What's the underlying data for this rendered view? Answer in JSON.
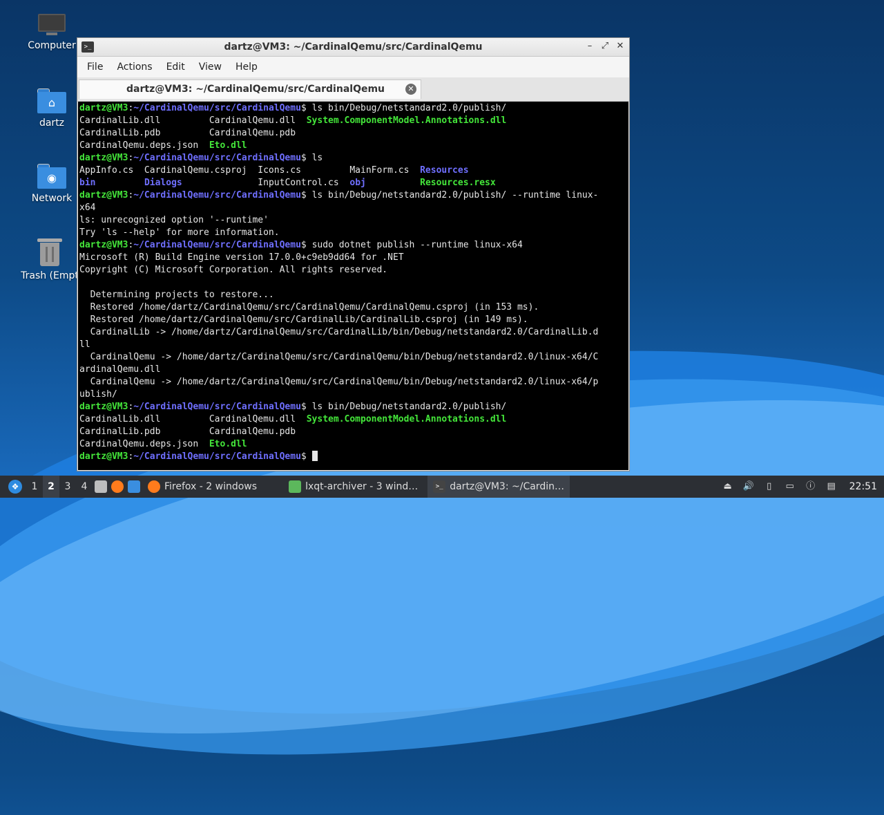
{
  "desktop": {
    "icons": [
      {
        "label": "Computer"
      },
      {
        "label": "dartz"
      },
      {
        "label": "Network"
      },
      {
        "label": "Trash (Empt"
      }
    ]
  },
  "window": {
    "title": "dartz@VM3: ~/CardinalQemu/src/CardinalQemu",
    "menu": [
      "File",
      "Actions",
      "Edit",
      "View",
      "Help"
    ],
    "tab_title": "dartz@VM3: ~/CardinalQemu/src/CardinalQemu",
    "controls": {
      "minimize": "–",
      "maximize": "⤢",
      "close": "✕"
    }
  },
  "terminal": {
    "prompt_user": "dartz@VM3",
    "prompt_path": "~/CardinalQemu/src/CardinalQemu",
    "lines": [
      [
        {
          "t": "dartz@VM3",
          "c": "g"
        },
        {
          "t": ":"
        },
        {
          "t": "~/CardinalQemu/src/CardinalQemu",
          "c": "b"
        },
        {
          "t": "$ ls bin/Debug/netstandard2.0/publish/"
        }
      ],
      [
        {
          "t": "CardinalLib.dll         CardinalQemu.dll  "
        },
        {
          "t": "System.ComponentModel.Annotations.dll",
          "c": "g"
        }
      ],
      [
        {
          "t": "CardinalLib.pdb         CardinalQemu.pdb"
        }
      ],
      [
        {
          "t": "CardinalQemu.deps.json  "
        },
        {
          "t": "Eto.dll",
          "c": "g"
        }
      ],
      [
        {
          "t": "dartz@VM3",
          "c": "g"
        },
        {
          "t": ":"
        },
        {
          "t": "~/CardinalQemu/src/CardinalQemu",
          "c": "b"
        },
        {
          "t": "$ ls"
        }
      ],
      [
        {
          "t": "AppInfo.cs  CardinalQemu.csproj  Icons.cs         MainForm.cs  "
        },
        {
          "t": "Resources",
          "c": "b"
        }
      ],
      [
        {
          "t": "bin",
          "c": "b"
        },
        {
          "t": "         "
        },
        {
          "t": "Dialogs",
          "c": "b"
        },
        {
          "t": "              InputControl.cs  "
        },
        {
          "t": "obj",
          "c": "b"
        },
        {
          "t": "          "
        },
        {
          "t": "Resources.resx",
          "c": "g"
        }
      ],
      [
        {
          "t": "dartz@VM3",
          "c": "g"
        },
        {
          "t": ":"
        },
        {
          "t": "~/CardinalQemu/src/CardinalQemu",
          "c": "b"
        },
        {
          "t": "$ ls bin/Debug/netstandard2.0/publish/ --runtime linux-"
        }
      ],
      [
        {
          "t": "x64"
        }
      ],
      [
        {
          "t": "ls: unrecognized option '--runtime'"
        }
      ],
      [
        {
          "t": "Try 'ls --help' for more information."
        }
      ],
      [
        {
          "t": "dartz@VM3",
          "c": "g"
        },
        {
          "t": ":"
        },
        {
          "t": "~/CardinalQemu/src/CardinalQemu",
          "c": "b"
        },
        {
          "t": "$ sudo dotnet publish --runtime linux-x64"
        }
      ],
      [
        {
          "t": "Microsoft (R) Build Engine version 17.0.0+c9eb9dd64 for .NET"
        }
      ],
      [
        {
          "t": "Copyright (C) Microsoft Corporation. All rights reserved."
        }
      ],
      [
        {
          "t": ""
        }
      ],
      [
        {
          "t": "  Determining projects to restore..."
        }
      ],
      [
        {
          "t": "  Restored /home/dartz/CardinalQemu/src/CardinalQemu/CardinalQemu.csproj (in 153 ms)."
        }
      ],
      [
        {
          "t": "  Restored /home/dartz/CardinalQemu/src/CardinalLib/CardinalLib.csproj (in 149 ms)."
        }
      ],
      [
        {
          "t": "  CardinalLib -> /home/dartz/CardinalQemu/src/CardinalLib/bin/Debug/netstandard2.0/CardinalLib.d"
        }
      ],
      [
        {
          "t": "ll"
        }
      ],
      [
        {
          "t": "  CardinalQemu -> /home/dartz/CardinalQemu/src/CardinalQemu/bin/Debug/netstandard2.0/linux-x64/C"
        }
      ],
      [
        {
          "t": "ardinalQemu.dll"
        }
      ],
      [
        {
          "t": "  CardinalQemu -> /home/dartz/CardinalQemu/src/CardinalQemu/bin/Debug/netstandard2.0/linux-x64/p"
        }
      ],
      [
        {
          "t": "ublish/"
        }
      ],
      [
        {
          "t": "dartz@VM3",
          "c": "g"
        },
        {
          "t": ":"
        },
        {
          "t": "~/CardinalQemu/src/CardinalQemu",
          "c": "b"
        },
        {
          "t": "$ ls bin/Debug/netstandard2.0/publish/"
        }
      ],
      [
        {
          "t": "CardinalLib.dll         CardinalQemu.dll  "
        },
        {
          "t": "System.ComponentModel.Annotations.dll",
          "c": "g"
        }
      ],
      [
        {
          "t": "CardinalLib.pdb         CardinalQemu.pdb"
        }
      ],
      [
        {
          "t": "CardinalQemu.deps.json  "
        },
        {
          "t": "Eto.dll",
          "c": "g"
        }
      ],
      [
        {
          "t": "dartz@VM3",
          "c": "g"
        },
        {
          "t": ":"
        },
        {
          "t": "~/CardinalQemu/src/CardinalQemu",
          "c": "b"
        },
        {
          "t": "$ "
        }
      ]
    ]
  },
  "taskbar": {
    "workspaces": [
      "1",
      "2",
      "3",
      "4"
    ],
    "active_workspace": "2",
    "windows": [
      {
        "label": "Firefox - 2 windows",
        "icon": "firefox-icon"
      },
      {
        "label": "lxqt-archiver - 3 wind…",
        "icon": "archiver-icon"
      },
      {
        "label": "dartz@VM3: ~/Cardin…",
        "icon": "terminal-icon"
      }
    ],
    "clock": "22:51"
  },
  "colors": {
    "prompt_green": "#44e63a",
    "path_blue": "#6f6fff",
    "terminal_bg": "#000000",
    "taskbar_bg": "#2c2f34"
  }
}
